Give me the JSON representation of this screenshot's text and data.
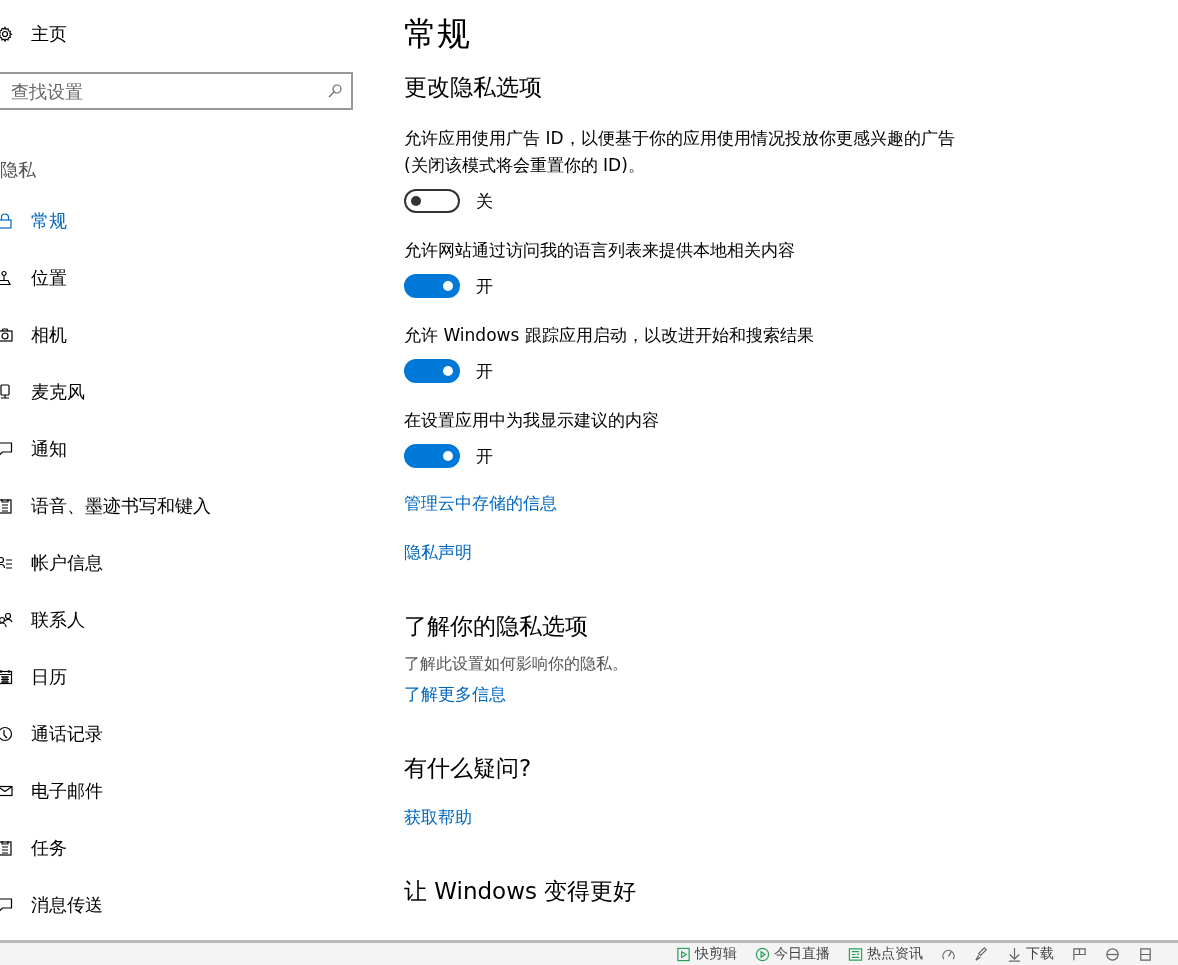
{
  "sidebar": {
    "home": {
      "label": "主页"
    },
    "search": {
      "placeholder": "查找设置"
    },
    "section_title": "隐私",
    "items": [
      {
        "label": "常规",
        "selected": true
      },
      {
        "label": "位置",
        "selected": false
      },
      {
        "label": "相机",
        "selected": false
      },
      {
        "label": "麦克风",
        "selected": false
      },
      {
        "label": "通知",
        "selected": false
      },
      {
        "label": "语音、墨迹书写和键入",
        "selected": false
      },
      {
        "label": "帐户信息",
        "selected": false
      },
      {
        "label": "联系人",
        "selected": false
      },
      {
        "label": "日历",
        "selected": false
      },
      {
        "label": "通话记录",
        "selected": false
      },
      {
        "label": "电子邮件",
        "selected": false
      },
      {
        "label": "任务",
        "selected": false
      },
      {
        "label": "消息传送",
        "selected": false
      }
    ]
  },
  "main": {
    "title": "常规",
    "sections": [
      {
        "heading": "更改隐私选项",
        "blocks": [
          {
            "kind": "toggle",
            "label": "允许应用使用广告 ID，以便基于你的应用使用情况投放你更感兴趣的广告(关闭该模式将会重置你的 ID)。",
            "on": false,
            "state_text": "关"
          },
          {
            "kind": "toggle",
            "label": "允许网站通过访问我的语言列表来提供本地相关内容",
            "on": true,
            "state_text": "开"
          },
          {
            "kind": "toggle",
            "label": "允许 Windows 跟踪应用启动，以改进开始和搜索结果",
            "on": true,
            "state_text": "开"
          },
          {
            "kind": "toggle",
            "label": "在设置应用中为我显示建议的内容",
            "on": true,
            "state_text": "开"
          },
          {
            "kind": "link",
            "label": "管理云中存储的信息"
          },
          {
            "kind": "link",
            "label": "隐私声明"
          }
        ]
      },
      {
        "heading": "了解你的隐私选项",
        "blocks": [
          {
            "kind": "text",
            "label": "了解此设置如何影响你的隐私。"
          },
          {
            "kind": "link",
            "label": "了解更多信息"
          }
        ]
      },
      {
        "heading": "有什么疑问?",
        "blocks": [
          {
            "kind": "link",
            "label": "获取帮助"
          }
        ]
      },
      {
        "heading": "让 Windows 变得更好"
      }
    ]
  },
  "bottom_bar": {
    "items": [
      {
        "label": "快剪辑"
      },
      {
        "label": "今日直播"
      },
      {
        "label": "热点资讯"
      },
      {
        "label": "下载"
      }
    ]
  }
}
